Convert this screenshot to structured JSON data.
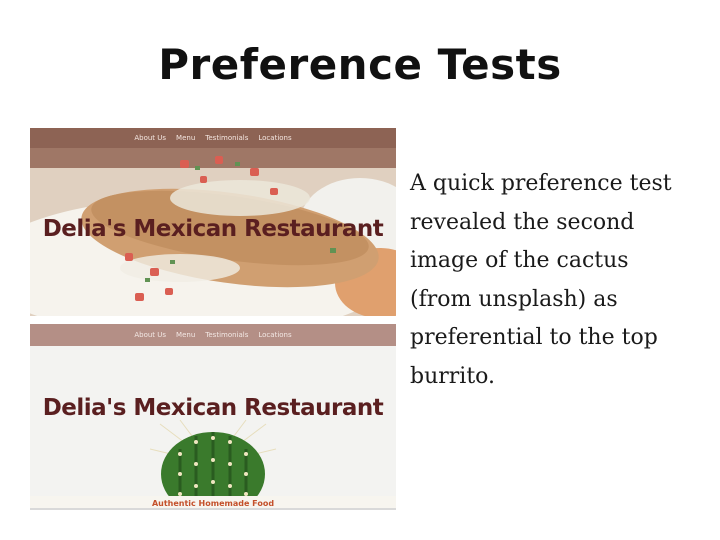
{
  "slide": {
    "title": "Preference Tests",
    "body": "A quick preference test revealed the second image of the cactus (from unsplash) as preferential to the top burrito."
  },
  "mockups": [
    {
      "nav": [
        "About Us",
        "Menu",
        "Testimonials",
        "Locations"
      ],
      "brand": "Delia's Mexican Restaurant",
      "image": "burrito-photo"
    },
    {
      "nav": [
        "About Us",
        "Menu",
        "Testimonials",
        "Locations"
      ],
      "brand": "Delia's Mexican Restaurant",
      "tagline": "Authentic Homemade Food",
      "image": "cactus-photo"
    }
  ],
  "colors": {
    "brand_text": "#5a1f20",
    "nav_bar": "#b48f86",
    "tagline": "#c4502a"
  }
}
